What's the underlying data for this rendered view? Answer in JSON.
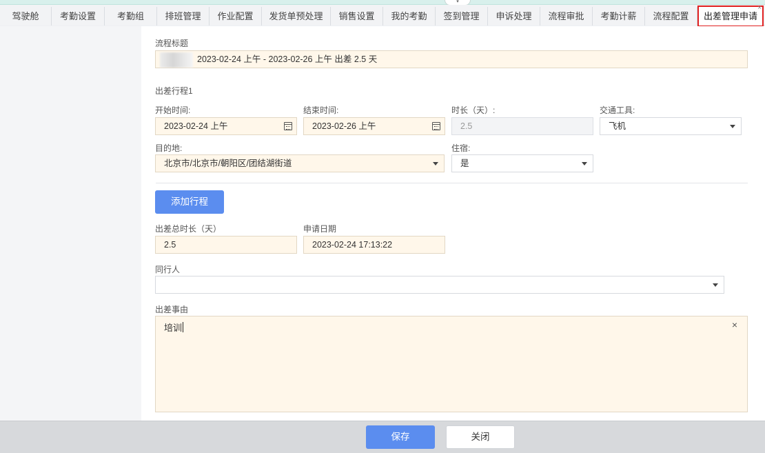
{
  "collapse_handle": "▾",
  "tabs": [
    {
      "label": "驾驶舱"
    },
    {
      "label": "考勤设置"
    },
    {
      "label": "考勤组"
    },
    {
      "label": "排班管理"
    },
    {
      "label": "作业配置"
    },
    {
      "label": "发货单预处理"
    },
    {
      "label": "销售设置"
    },
    {
      "label": "我的考勤"
    },
    {
      "label": "签到管理"
    },
    {
      "label": "申诉处理"
    },
    {
      "label": "流程审批"
    },
    {
      "label": "考勤计薪"
    },
    {
      "label": "流程配置"
    },
    {
      "label": "出差管理申请",
      "active": true,
      "close": "×"
    }
  ],
  "form": {
    "title_label": "流程标题",
    "title_value": "2023-02-24 上午 - 2023-02-26 上午 出差 2.5 天",
    "trip_section": "出差行程1",
    "start_label": "开始时间:",
    "start_value": "2023-02-24 上午",
    "end_label": "结束时间:",
    "end_value": "2023-02-26 上午",
    "duration_label": "时长（天）:",
    "duration_value": "2.5",
    "transport_label": "交通工具:",
    "transport_value": "飞机",
    "destination_label": "目的地:",
    "destination_value": "北京市/北京市/朝阳区/团结湖街道",
    "lodging_label": "住宿:",
    "lodging_value": "是",
    "add_trip_button": "添加行程",
    "total_label": "出差总时长（天）",
    "total_value": "2.5",
    "apply_date_label": "申请日期",
    "apply_date_value": "2023-02-24 17:13:22",
    "companion_label": "同行人",
    "companion_value": "",
    "reason_label": "出差事由",
    "reason_value": "培训",
    "reason_clear": "×"
  },
  "footer": {
    "save_label": "保存",
    "close_label": "关闭"
  },
  "colors": {
    "primary": "#5b8def",
    "field_bg": "#fff7ea",
    "active_tab_border": "#e02020"
  }
}
